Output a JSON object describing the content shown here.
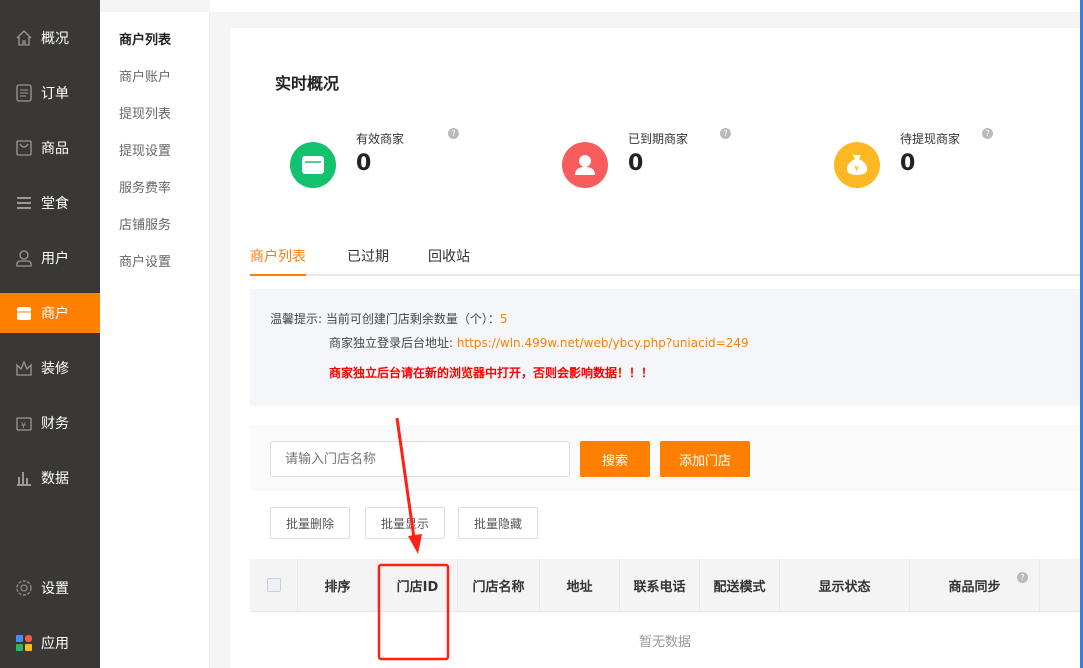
{
  "sidebar": {
    "items": [
      {
        "label": "概况",
        "icon": "home-icon"
      },
      {
        "label": "订单",
        "icon": "order-icon"
      },
      {
        "label": "商品",
        "icon": "bag-icon"
      },
      {
        "label": "堂食",
        "icon": "menu-icon"
      },
      {
        "label": "用户",
        "icon": "user-icon"
      },
      {
        "label": "商户",
        "icon": "store-icon",
        "active": true
      },
      {
        "label": "装修",
        "icon": "crown-icon"
      },
      {
        "label": "财务",
        "icon": "wallet-icon"
      },
      {
        "label": "数据",
        "icon": "chart-icon"
      },
      {
        "label": "设置",
        "icon": "gear-icon"
      },
      {
        "label": "应用",
        "icon": "apps-icon"
      }
    ]
  },
  "submenu": [
    "商户列表",
    "商户账户",
    "提现列表",
    "提现设置",
    "服务费率",
    "店铺服务",
    "商户设置"
  ],
  "overview": {
    "title": "实时概况",
    "stats": [
      {
        "label": "有效商家",
        "value": "0",
        "color": "#13c26e"
      },
      {
        "label": "已到期商家",
        "value": "0",
        "color": "#f85c5c"
      },
      {
        "label": "待提现商家",
        "value": "0",
        "color": "#fdb823"
      }
    ]
  },
  "tabs": [
    "商户列表",
    "已过期",
    "回收站"
  ],
  "notice": {
    "prefix": "温馨提示:",
    "line1": "当前可创建门店剩余数量（个）：",
    "count": "5",
    "line2": "商家独立登录后台地址:",
    "url": "https://wln.499w.net/web/ybcy.php?uniacid=249",
    "warning": "商家独立后台请在新的浏览器中打开，否则会影响数据！！！"
  },
  "search": {
    "placeholder": "请输入门店名称",
    "search_label": "搜索",
    "add_label": "添加门店"
  },
  "batch": [
    "批量删除",
    "批量显示",
    "批量隐藏"
  ],
  "table": {
    "headers": [
      "排序",
      "门店ID",
      "门店名称",
      "地址",
      "联系电话",
      "配送模式",
      "显示状态",
      "商品同步"
    ],
    "empty": "暂无数据"
  },
  "colors": {
    "accent": "#ff8000",
    "warning": "#ff0000"
  }
}
